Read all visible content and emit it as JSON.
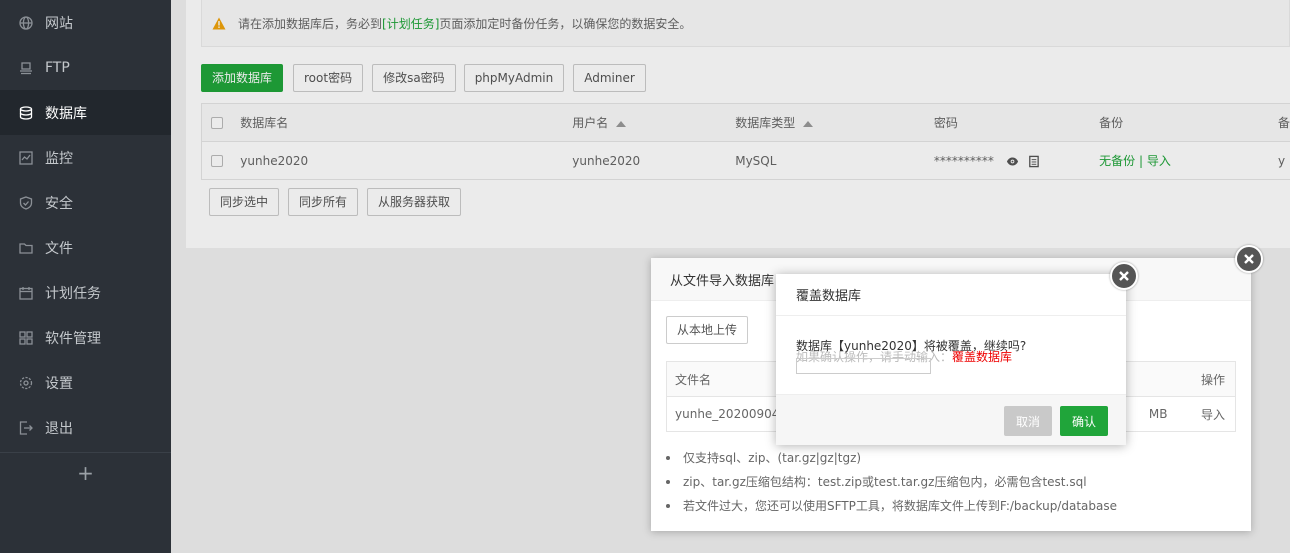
{
  "sidebar": {
    "items": [
      {
        "label": "网站",
        "icon": "globe-icon"
      },
      {
        "label": "FTP",
        "icon": "ftp-icon"
      },
      {
        "label": "数据库",
        "icon": "database-icon"
      },
      {
        "label": "监控",
        "icon": "monitor-icon"
      },
      {
        "label": "安全",
        "icon": "shield-icon"
      },
      {
        "label": "文件",
        "icon": "folder-icon"
      },
      {
        "label": "计划任务",
        "icon": "calendar-icon"
      },
      {
        "label": "软件管理",
        "icon": "apps-icon"
      },
      {
        "label": "设置",
        "icon": "gear-icon"
      },
      {
        "label": "退出",
        "icon": "logout-icon"
      }
    ],
    "active_index": 2,
    "add_label": "+"
  },
  "warning": {
    "prefix": "请在添加数据库后，务必到",
    "link": "[计划任务]",
    "suffix": "页面添加定时备份任务，以确保您的数据安全。"
  },
  "toolbar": {
    "buttons": [
      "添加数据库",
      "root密码",
      "修改sa密码",
      "phpMyAdmin",
      "Adminer"
    ]
  },
  "table": {
    "headers": [
      "数据库名",
      "用户名",
      "数据库类型",
      "密码",
      "备份",
      "备"
    ],
    "rows": [
      {
        "name": "yunhe2020",
        "user": "yunhe2020",
        "type": "MySQL",
        "password": "**********",
        "backup_none": "无备份",
        "sep": "|",
        "import": "导入",
        "extra": "y"
      }
    ]
  },
  "bottom_buttons": [
    "同步选中",
    "同步所有",
    "从服务器获取"
  ],
  "import_dialog": {
    "title": "从文件导入数据库",
    "upload_label": "从本地上传",
    "col_filename": "文件名",
    "col_action": "操作",
    "file_name": "yunhe_20200904_",
    "file_size": "MB",
    "file_action": "导入",
    "notes": [
      "仅支持sql、zip、(tar.gz|gz|tgz)",
      "zip、tar.gz压缩包结构：test.zip或test.tar.gz压缩包内，必需包含test.sql",
      "若文件过大，您还可以使用SFTP工具，将数据库文件上传到F:/backup/database"
    ]
  },
  "confirm_dialog": {
    "title": "覆盖数据库",
    "message": "数据库【yunhe2020】将被覆盖，继续吗?",
    "hint_prefix": "如果确认操作，请手动输入：",
    "hint_red": "覆盖数据库",
    "cancel_label": "取消",
    "ok_label": "确认"
  },
  "colors": {
    "accent": "#20a53a",
    "sidebar_bg": "#2c3138",
    "danger": "#e00000"
  }
}
